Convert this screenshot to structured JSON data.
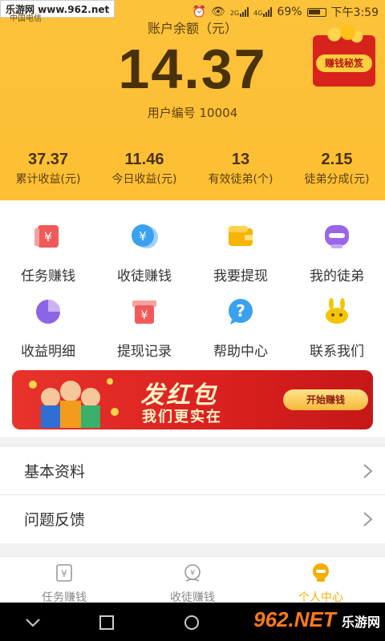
{
  "watermark": "乐游网 www.962.net",
  "status_bar": {
    "carrier": "中国电信",
    "signal_labels": [
      "2G",
      "4G"
    ],
    "battery": "69%",
    "time": "下午3:59"
  },
  "header": {
    "balance_label": "账户余额（元）",
    "balance_value": "14.37",
    "user_id": "用户编号 10004",
    "promo_label": "赚钱秘笈",
    "stats": [
      {
        "value": "37.37",
        "label": "累计收益(元)"
      },
      {
        "value": "11.46",
        "label": "今日收益(元)"
      },
      {
        "value": "13",
        "label": "有效徒弟(个)"
      },
      {
        "value": "2.15",
        "label": "徒弟分成(元)"
      }
    ]
  },
  "grid": [
    {
      "label": "任务赚钱",
      "icon": "task-money-icon",
      "color": "#f25a5a"
    },
    {
      "label": "收徒赚钱",
      "icon": "recruit-money-icon",
      "color": "#3aa0f0"
    },
    {
      "label": "我要提现",
      "icon": "wallet-icon",
      "color": "#f5b400"
    },
    {
      "label": "我的徒弟",
      "icon": "chat-face-icon",
      "color": "#9a66e8"
    },
    {
      "label": "收益明细",
      "icon": "pie-chart-icon",
      "color": "#8c64e6"
    },
    {
      "label": "提现记录",
      "icon": "withdraw-record-icon",
      "color": "#f25a5a"
    },
    {
      "label": "帮助中心",
      "icon": "help-icon",
      "color": "#3aa0f0"
    },
    {
      "label": "联系我们",
      "icon": "contact-icon",
      "color": "#f5c400"
    }
  ],
  "banner": {
    "title": "发红包",
    "subtitle": "我们更实在",
    "button": "开始赚钱"
  },
  "list": [
    {
      "label": "基本资料"
    },
    {
      "label": "问题反馈"
    }
  ],
  "tabs": [
    {
      "label": "任务赚钱",
      "icon": "yuan-card-icon",
      "active": false
    },
    {
      "label": "收徒赚钱",
      "icon": "recruit-icon",
      "active": false
    },
    {
      "label": "个人中心",
      "icon": "profile-icon",
      "active": true
    }
  ],
  "footer_watermark": {
    "main": "962.NET",
    "sub": "乐游网"
  },
  "colors": {
    "header": "#fdbf33",
    "accent": "#f3b000",
    "banner": "#d91f1f"
  }
}
